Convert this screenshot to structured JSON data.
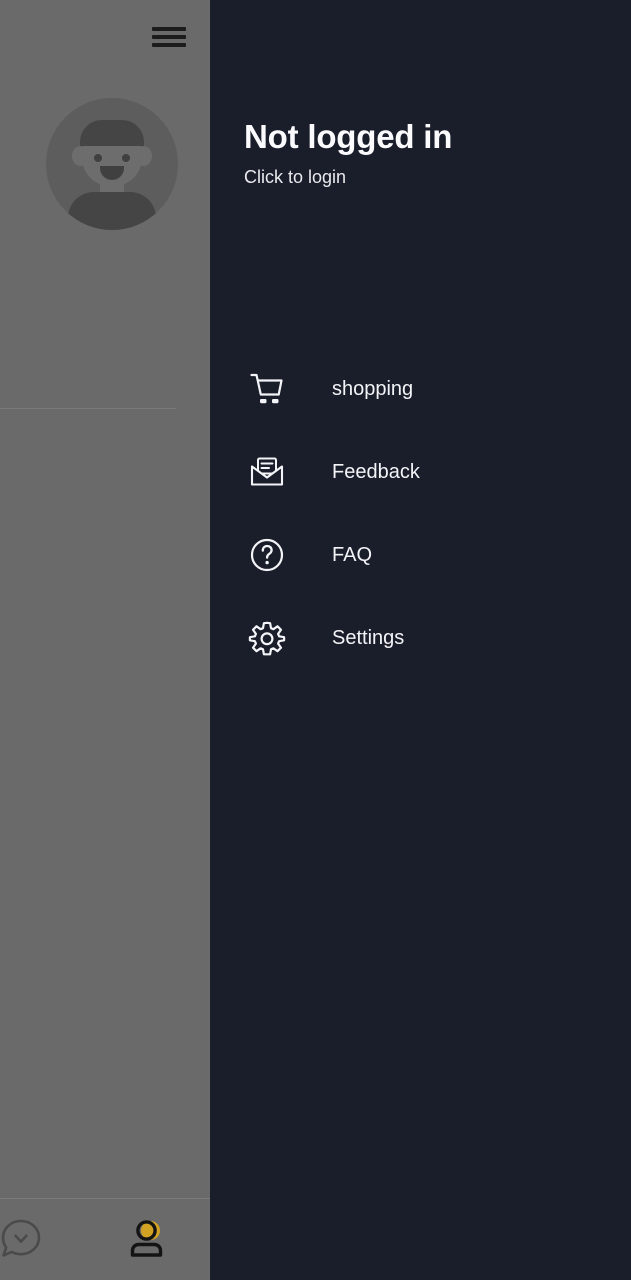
{
  "app_behind": {
    "menu_button": {
      "name": "hamburger-menu",
      "icon": "hamburger-icon"
    },
    "avatar": {
      "name": "user-avatar",
      "icon": "avatar-person-icon"
    },
    "bottom_nav": {
      "items": [
        {
          "icon": "chat-bubble-icon",
          "name": "chat-tab",
          "active": false
        },
        {
          "icon": "person-icon",
          "name": "profile-tab",
          "active": true,
          "accent": "#d8a520"
        }
      ]
    }
  },
  "drawer": {
    "title": "Not logged in",
    "subtitle": "Click to login",
    "menu": [
      {
        "icon": "shopping-cart-icon",
        "label": "shopping"
      },
      {
        "icon": "feedback-envelope-icon",
        "label": "Feedback"
      },
      {
        "icon": "question-circle-icon",
        "label": "FAQ"
      },
      {
        "icon": "settings-gear-icon",
        "label": "Settings"
      }
    ]
  },
  "colors": {
    "drawer_bg": "#1a1d2a",
    "scrim": "#6a6a6a",
    "text_primary": "#fbfbfd",
    "text_secondary": "#e9eaee",
    "icon_stroke": "#f3f4f7",
    "accent_yellow": "#d8a520"
  }
}
